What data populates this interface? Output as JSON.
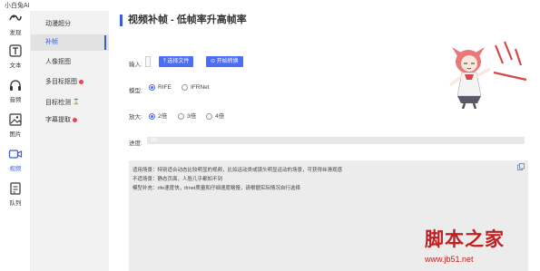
{
  "app": {
    "title": "小白兔AI"
  },
  "rail": [
    {
      "label": "发现",
      "icon": "discover-icon"
    },
    {
      "label": "文本",
      "icon": "text-icon"
    },
    {
      "label": "音频",
      "icon": "headphones-icon"
    },
    {
      "label": "图片",
      "icon": "image-icon"
    },
    {
      "label": "视频",
      "icon": "video-icon"
    },
    {
      "label": "队列",
      "icon": "queue-icon"
    }
  ],
  "sub_nav": [
    {
      "label": "动漫超分"
    },
    {
      "label": "补帧"
    },
    {
      "label": "人像抠图"
    },
    {
      "label": "多目标抠图"
    },
    {
      "label": "目标检测"
    },
    {
      "label": "字幕提取"
    }
  ],
  "main": {
    "title": "视频补帧 - 低帧率升高帧率",
    "input_label": "输入:",
    "select_file_button": "选择文件",
    "start_convert_button": "开始转换",
    "model_label": "模型:",
    "model_options": [
      "RIFE",
      "IFRNet"
    ],
    "model_selected": "RIFE",
    "scale_label": "放大:",
    "scale_options": [
      "2倍",
      "3倍",
      "4倍"
    ],
    "scale_selected": "2倍",
    "progress_label": "进度:",
    "progress_text": "0%",
    "progress_value": 0,
    "info_lines": [
      "适用场景：特别适合动态比较明显的视频，比如运动类或镜头明显运动的场景，可获得丝滑观感",
      "不适场景：静态页面，人脸几乎都知不到",
      "模型补充：rife速度快，ifrnet质量和仔细速度略慢，请根据实际情况自行选择"
    ]
  },
  "watermark": {
    "title": "脚本之家",
    "url": "www.jb51.net"
  },
  "colors": {
    "accent": "#4c6ef5",
    "active_nav": "#3b5bd9",
    "watermark": "#c02020"
  }
}
